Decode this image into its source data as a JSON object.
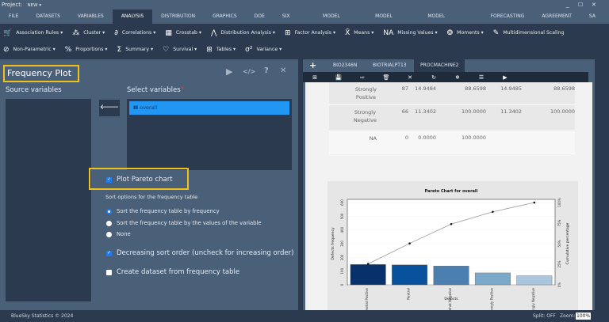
{
  "titlebar": {
    "project_label": "Project:",
    "project_name": "NEW ▾",
    "minimize": "_",
    "maximize": "☐",
    "close": "✕"
  },
  "menu": [
    "FILE",
    "DATASETS",
    "VARIABLES",
    "ANALYSIS",
    "DISTRIBUTION",
    "GRAPHICS",
    "DOE",
    "SIX SIGMA",
    "MODEL FITTING",
    "MODEL TUNING",
    "MODEL EVALUATION",
    "FORECASTING",
    "AGREEMENT",
    "SA ❯"
  ],
  "menu_active": "ANALYSIS",
  "toolbar1": [
    {
      "icon": "cart-icon",
      "glyph": "🛒",
      "label": "Association Rules ▾"
    },
    {
      "icon": "cluster-icon",
      "glyph": "⁂",
      "label": "Cluster ▾"
    },
    {
      "icon": "correlation-icon",
      "glyph": "∂",
      "label": "Correlations ▾"
    },
    {
      "icon": "grid-icon",
      "glyph": "▦",
      "label": "Crosstab ▾"
    },
    {
      "icon": "distribution-icon",
      "glyph": "⋀",
      "label": "Distribution Analysis ▾"
    },
    {
      "icon": "factor-icon",
      "glyph": "⊞",
      "label": "Factor Analysis ▾"
    },
    {
      "icon": "means-icon",
      "glyph": "X̄",
      "label": "Means ▾"
    },
    {
      "icon": "missing-icon",
      "glyph": "NA",
      "label": "Missing Values ▾"
    },
    {
      "icon": "moments-icon",
      "glyph": "❂",
      "label": "Moments ▾"
    },
    {
      "icon": "pencil-icon",
      "glyph": "✎",
      "label": "Multidimensional Scaling"
    }
  ],
  "toolbar2": [
    {
      "icon": "nonparametric-icon",
      "glyph": "⊘",
      "label": "Non-Parametric ▾"
    },
    {
      "icon": "percent-icon",
      "glyph": "%",
      "label": "Proportions ▾"
    },
    {
      "icon": "sigma-icon",
      "glyph": "Σ",
      "label": "Summary ▾"
    },
    {
      "icon": "heart-icon",
      "glyph": "♡",
      "label": "Survival ▾"
    },
    {
      "icon": "table-icon",
      "glyph": "⊞",
      "label": "Tables ▾"
    },
    {
      "icon": "variance-icon",
      "glyph": "σ²",
      "label": "Variance ▾"
    }
  ],
  "dialog": {
    "title": "Frequency Plot",
    "source_label": "Source variables",
    "select_label": "Select variables",
    "required_mark": "*",
    "selected_variable": "overall",
    "move_arrow": "🡐",
    "plot_pareto": {
      "label": "Plot Pareto chart",
      "checked": true
    },
    "sort_label": "Sort options for the frequency table",
    "sort_options": [
      {
        "label": "Sort the frequency table by frequency",
        "selected": true
      },
      {
        "label": "Sort the frequency table by the values of the variable",
        "selected": false
      },
      {
        "label": "None",
        "selected": false
      }
    ],
    "decreasing": {
      "label": "Decreasing sort order (uncheck for increasing order)",
      "checked": true
    },
    "create_dataset": {
      "label": "Create dataset from frequency table",
      "checked": false
    },
    "icons": {
      "run": "▶",
      "code": "</>",
      "help": "?",
      "close": "✕"
    }
  },
  "output": {
    "add_tab": "+",
    "tabs": [
      "BIO2346N",
      "BIOTRIALPT13",
      "PROCMACHINE2"
    ],
    "active_tab": "PROCMACHINE2",
    "toolbar_icons": [
      {
        "name": "add-icon",
        "glyph": "⊞"
      },
      {
        "name": "save-icon",
        "glyph": "💾"
      },
      {
        "name": "export-icon",
        "glyph": "⇨"
      },
      {
        "name": "delete-icon",
        "glyph": "🗑"
      },
      {
        "name": "clear-icon",
        "glyph": "✕"
      },
      {
        "name": "refresh-icon",
        "glyph": "↻"
      },
      {
        "name": "freeze-icon",
        "glyph": "❄"
      },
      {
        "name": "list-icon",
        "glyph": "☰"
      },
      {
        "name": "run-icon",
        "glyph": "▶"
      }
    ],
    "table_rows": [
      {
        "label": [
          "Strongly",
          "Positive"
        ],
        "cells": [
          "87",
          "14.9484",
          "88.6598",
          "14.9485",
          "88.6598"
        ]
      },
      {
        "label": [
          "Strongly",
          "Negative"
        ],
        "cells": [
          "66",
          "11.3402",
          "100.0000",
          "11.3402",
          "100.0000"
        ]
      },
      {
        "label": [
          "NA",
          ""
        ],
        "cells": [
          "0",
          "0.0000",
          "100.0000",
          "",
          ""
        ]
      }
    ]
  },
  "chart_data": {
    "type": "bar",
    "title": "Pareto Chart for overall",
    "xlabel": "Defects",
    "ylabel": "Defects frequency",
    "ylabel_right": "Cumulative percentage",
    "categories": [
      "Somewhat Positive",
      "Neutral",
      "Somewhat Negative",
      "Strongly Positive",
      "Strongly Negative"
    ],
    "values": [
      148,
      145,
      137,
      87,
      66
    ],
    "cumulative_percent": [
      25.4,
      50.3,
      73.8,
      88.7,
      100
    ],
    "ylim": [
      0,
      600
    ],
    "yticks": [
      0,
      100,
      200,
      300,
      400,
      500,
      600
    ],
    "yticks_right": [
      "0%",
      "25%",
      "50%",
      "75%",
      "100%"
    ],
    "colors": [
      "#08306b",
      "#08519c",
      "#4a7fb0",
      "#7ba7c9",
      "#a9c6e0"
    ],
    "line_color": "#999999"
  },
  "status": {
    "copyright": "BlueSky Statistics © 2024",
    "split": "Split: OFF",
    "zoom_label": "Zoom:",
    "zoom_value": "100%"
  }
}
